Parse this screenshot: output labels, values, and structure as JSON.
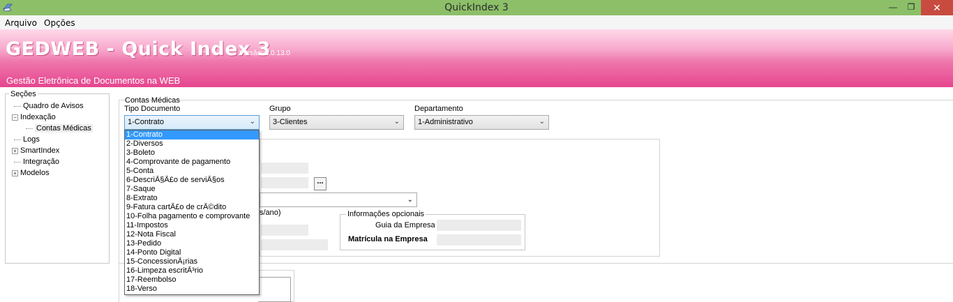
{
  "window": {
    "title": "QuickIndex 3",
    "minimize_glyph": "—",
    "maximize_glyph": "❐",
    "close_glyph": "✕"
  },
  "menu": {
    "items": [
      "Arquivo",
      "Opções"
    ]
  },
  "banner": {
    "title": "GEDWEB - Quick Index 3",
    "version_label": "Versão:",
    "version": "3.0.13.0",
    "subtitle": "Gestão Eletrônica de Documentos na WEB"
  },
  "sidebar": {
    "legend": "Seções",
    "items": [
      {
        "label": "Quadro de Avisos",
        "expander": ""
      },
      {
        "label": "Indexação",
        "expander": "−"
      },
      {
        "label": "Contas Médicas",
        "expander": ""
      },
      {
        "label": "Logs",
        "expander": ""
      },
      {
        "label": "SmartIndex",
        "expander": "+"
      },
      {
        "label": "Integração",
        "expander": ""
      },
      {
        "label": "Modelos",
        "expander": "+"
      }
    ]
  },
  "form": {
    "group_label": "Contas Médicas",
    "tipo_documento": {
      "label": "Tipo Documento",
      "value": "1-Contrato"
    },
    "grupo": {
      "label": "Grupo",
      "value": "3-Clientes"
    },
    "departamento": {
      "label": "Departamento",
      "value": "1-Administrativo"
    },
    "partial_label": "s/ano)",
    "dots_button": "...",
    "opcionais": {
      "legend": "Informações opcionais",
      "guia_label": "Guia da Empresa",
      "matricula_label": "Matrícula na Empresa"
    }
  },
  "dropdown_options": [
    "1-Contrato",
    "2-Diversos",
    "3-Boleto",
    "4-Comprovante de pagamento",
    "5-Conta",
    "6-DescriÃ§Ã£o de serviÃ§os",
    "7-Saque",
    "8-Extrato",
    "9-Fatura cartÃ£o de crÃ©dito",
    "10-Folha pagamento e comprovante",
    "11-Impostos",
    "12-Nota Fiscal",
    "13-Pedido",
    "14-Ponto Digital",
    "15-ConcessionÃ¡rias",
    "16-Limpeza escritÃ³rio",
    "17-Reembolso",
    "18-Verso"
  ],
  "colors": {
    "titlebar": "#8cbf68",
    "banner_accent": "#e6458e",
    "close_button": "#c74c3f",
    "selection": "#3399ff"
  }
}
